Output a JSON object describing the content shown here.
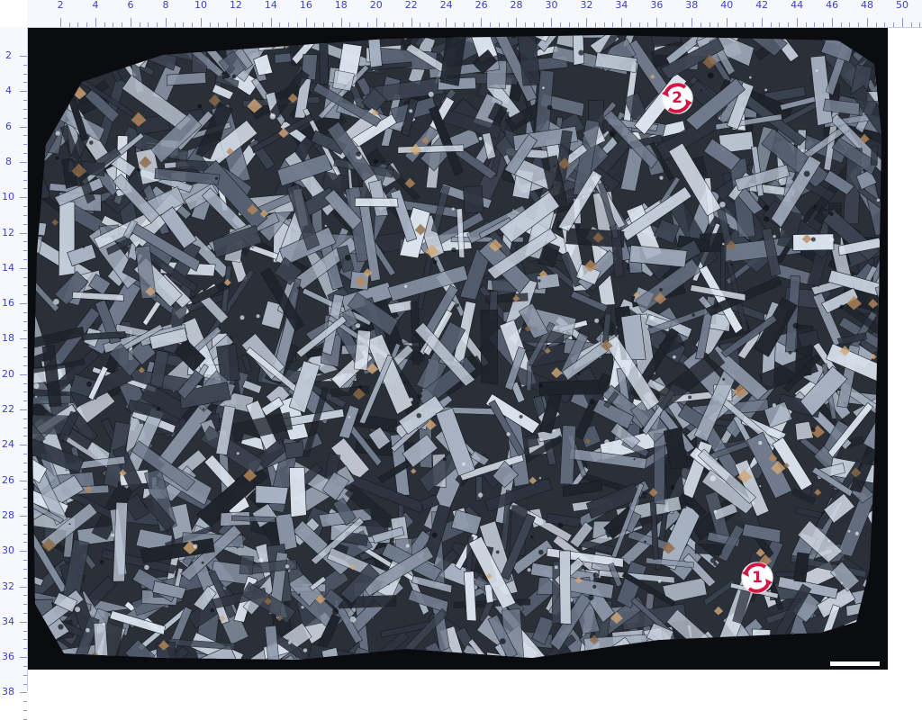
{
  "ruler": {
    "top_labels": [
      "2",
      "4",
      "6",
      "8",
      "10",
      "12",
      "14",
      "16",
      "18",
      "20",
      "22",
      "24",
      "26",
      "28",
      "30",
      "32",
      "34",
      "36",
      "38",
      "40",
      "42",
      "44",
      "46",
      "48",
      "50"
    ],
    "left_labels": [
      "2",
      "4",
      "6",
      "8",
      "10",
      "12",
      "14",
      "16",
      "18",
      "20",
      "22",
      "24",
      "26",
      "28",
      "30",
      "32",
      "34",
      "36",
      "38"
    ],
    "color": "#3b43c4"
  },
  "markers": [
    {
      "id": "2",
      "label": "2",
      "icon": "rotate-arrows-icon",
      "color": "#d41645"
    },
    {
      "id": "1",
      "label": "1",
      "icon": "rotate-arrows-icon",
      "color": "#d41645"
    }
  ],
  "image": {
    "description_icon": "thin-section-micrograph",
    "background": "#0b0c10",
    "crystal_palette": [
      "#1f242c",
      "#2e3440",
      "#3d4452",
      "#566071",
      "#707b8d",
      "#8b97a8",
      "#a7b2c2",
      "#c3cdd9",
      "#dce4ee"
    ],
    "accent_palette": [
      "#b7885b",
      "#8e6a46",
      "#d2a877"
    ]
  }
}
